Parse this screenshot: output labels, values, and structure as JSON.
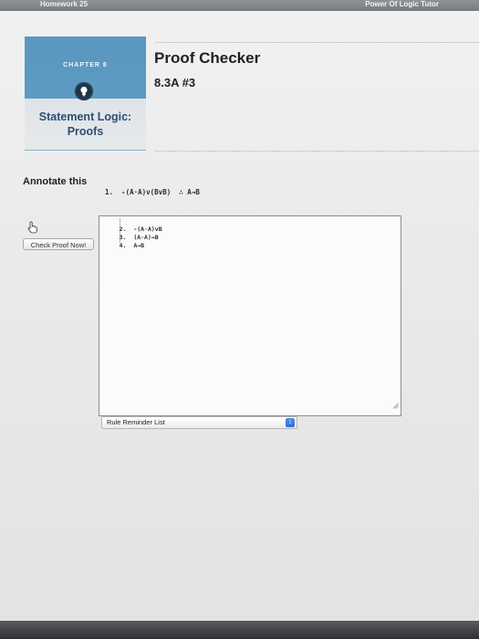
{
  "header": {
    "left_label": "Homework 25",
    "right_label": "Power Of Logic Tutor"
  },
  "chapter": {
    "label": "CHAPTER 8",
    "title_line1": "Statement Logic:",
    "title_line2": "Proofs",
    "icon": "lightbulb-icon"
  },
  "app": {
    "title": "Proof Checker",
    "exercise": "8.3A #3"
  },
  "annotate": {
    "heading": "Annotate this",
    "given_line": "1.  -(A·A)v(BvB)  ∴ A→B"
  },
  "proof": {
    "lines": [
      {
        "num": "2.",
        "text": "-(A·A)vB"
      },
      {
        "num": "3.",
        "text": "(A·A)→B"
      },
      {
        "num": "4.",
        "text": "A→B"
      }
    ]
  },
  "controls": {
    "check_button": "Check Proof Now!",
    "rule_select": "Rule Reminder List"
  },
  "colors": {
    "panel_blue": "#5c9bc3",
    "title_blue": "#2d4f73",
    "select_arrow": "#2d6fd6"
  }
}
